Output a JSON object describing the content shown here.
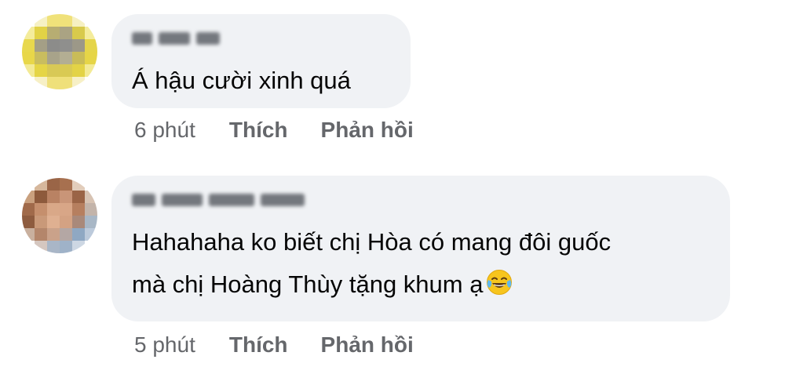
{
  "comments": [
    {
      "text": "Á hậu cười xinh quá",
      "time": "6 phút",
      "like_label": "Thích",
      "reply_label": "Phản hồi"
    },
    {
      "text": "Hahahaha ko biết chị Hòa có mang đôi guốc\nmà chị Hoàng Thùy tặng khum ạ",
      "time": "5 phút",
      "like_label": "Thích",
      "reply_label": "Phản hồi"
    }
  ],
  "colors": {
    "bubble_background": "#f0f2f5",
    "comment_text": "#050505",
    "meta_text": "#65676b",
    "emoji_face": "#f7c51e"
  },
  "icons": {
    "reaction_emoji": "face-with-tears-of-joy-icon"
  }
}
